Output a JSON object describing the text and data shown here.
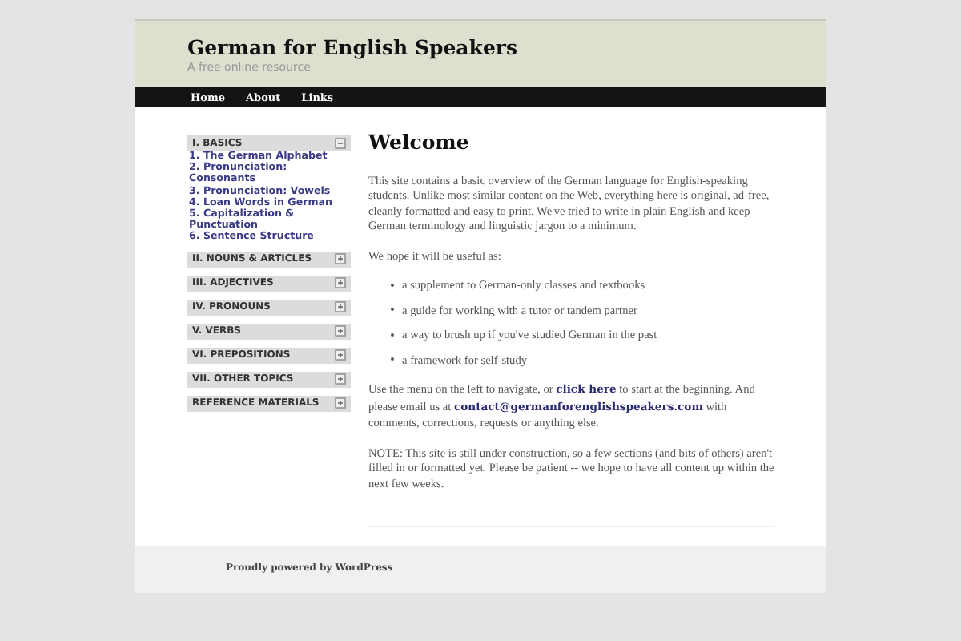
{
  "header": {
    "title": "German for English Speakers",
    "tagline": "A free online resource"
  },
  "nav": [
    "Home",
    "About",
    "Links"
  ],
  "sidebar": [
    {
      "label": "I. BASICS",
      "expanded": true,
      "items": [
        "1. The German Alphabet",
        "2. Pronunciation: Consonants",
        "3. Pronunciation: Vowels",
        "4. Loan Words in German",
        "5. Capitalization & Punctuation",
        "6. Sentence Structure"
      ]
    },
    {
      "label": "II. NOUNS & ARTICLES",
      "expanded": false
    },
    {
      "label": "III. ADJECTIVES",
      "expanded": false
    },
    {
      "label": "IV. PRONOUNS",
      "expanded": false
    },
    {
      "label": "V. VERBS",
      "expanded": false
    },
    {
      "label": "VI. PREPOSITIONS",
      "expanded": false
    },
    {
      "label": "VII. OTHER TOPICS",
      "expanded": false
    },
    {
      "label": "REFERENCE MATERIALS",
      "expanded": false
    }
  ],
  "content": {
    "heading": "Welcome",
    "blocks": [
      {
        "kind": "paragraph",
        "parts": [
          {
            "kind": "text",
            "text": "This site contains a basic overview of the German language for English-speaking students. Unlike most similar content on the Web, everything here is original, ad-free, cleanly formatted and easy to print. We've tried to write in plain English and keep German terminology and linguistic jargon to a minimum."
          }
        ]
      },
      {
        "kind": "paragraph",
        "parts": [
          {
            "kind": "text",
            "text": "We hope it will be useful as:"
          }
        ]
      },
      {
        "kind": "list",
        "items": [
          "a supplement to German-only classes and textbooks",
          "a guide for working with a tutor or tandem partner",
          "a way to brush up if you've studied German in the past",
          "a framework for self-study"
        ]
      },
      {
        "kind": "paragraph",
        "parts": [
          {
            "kind": "text",
            "text": "Use the menu on the left to navigate, or "
          },
          {
            "kind": "link",
            "text": "click here"
          },
          {
            "kind": "text",
            "text": " to start at the beginning. And please email us at "
          },
          {
            "kind": "link",
            "text": "contact@germanforenglishspeakers.com"
          },
          {
            "kind": "text",
            "text": " with comments, corrections, requests or anything else."
          }
        ]
      },
      {
        "kind": "paragraph",
        "parts": [
          {
            "kind": "text",
            "text": "NOTE: This site is still under construction, so a few sections (and bits of others) aren't filled in or formatted yet. Please be patient -- we hope to have all content up within the next few weeks."
          }
        ]
      }
    ]
  },
  "footer": "Proudly powered by WordPress"
}
